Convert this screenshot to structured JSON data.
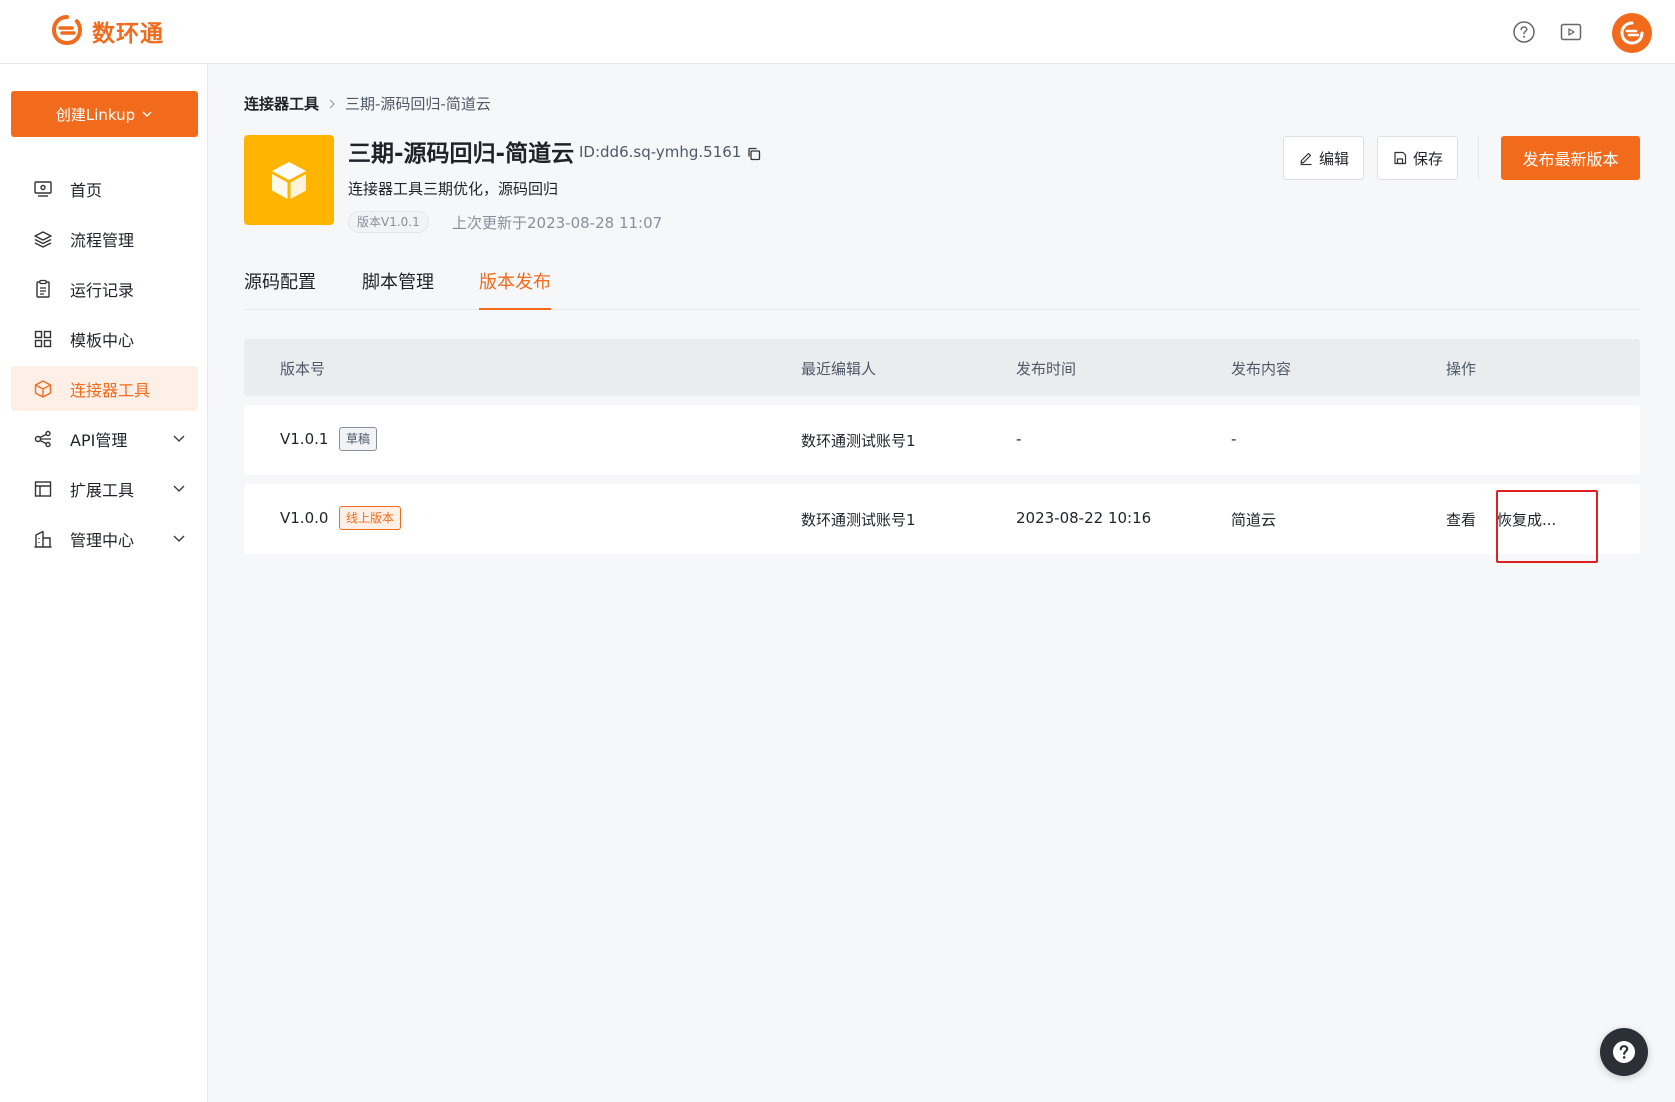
{
  "brand": {
    "name": "数环通",
    "accent": "#f26b1d"
  },
  "topbar": {
    "icons": [
      "help-circle-icon",
      "video-play-icon",
      "user-avatar-icon"
    ]
  },
  "sidebar": {
    "create_label": "创建Linkup",
    "items": [
      {
        "label": "首页",
        "icon": "monitor-icon",
        "active": false,
        "expandable": false
      },
      {
        "label": "流程管理",
        "icon": "layers-icon",
        "active": false,
        "expandable": false
      },
      {
        "label": "运行记录",
        "icon": "clipboard-icon",
        "active": false,
        "expandable": false
      },
      {
        "label": "模板中心",
        "icon": "grid-icon",
        "active": false,
        "expandable": false
      },
      {
        "label": "连接器工具",
        "icon": "cube-icon",
        "active": true,
        "expandable": false
      },
      {
        "label": "API管理",
        "icon": "api-icon",
        "active": false,
        "expandable": true
      },
      {
        "label": "扩展工具",
        "icon": "extension-icon",
        "active": false,
        "expandable": true
      },
      {
        "label": "管理中心",
        "icon": "building-icon",
        "active": false,
        "expandable": true
      }
    ]
  },
  "breadcrumb": {
    "root": "连接器工具",
    "separator": ">",
    "current": "三期-源码回归-简道云"
  },
  "connector": {
    "title": "三期-源码回归-简道云",
    "id_text": "ID:dd6.sq-ymhg.5161",
    "description": "连接器工具三期优化，源码回归",
    "version_tag": "版本V1.0.1",
    "updated": "上次更新于2023-08-28 11:07"
  },
  "actions": {
    "edit": "编辑",
    "save": "保存",
    "publish": "发布最新版本"
  },
  "tabs": [
    {
      "label": "源码配置",
      "active": false
    },
    {
      "label": "脚本管理",
      "active": false
    },
    {
      "label": "版本发布",
      "active": true
    }
  ],
  "table": {
    "headers": [
      "版本号",
      "最近编辑人",
      "发布时间",
      "发布内容",
      "操作"
    ],
    "rows": [
      {
        "version": "V1.0.1",
        "tag": "草稿",
        "editor": "数环通测试账号1",
        "time": "-",
        "content": "-",
        "actions": []
      },
      {
        "version": "V1.0.0",
        "tag": "线上版本",
        "editor": "数环通测试账号1",
        "time": "2023-08-22 10:16",
        "content": "简道云",
        "actions": [
          "查看",
          "恢复成..."
        ]
      }
    ]
  },
  "colors": {
    "highlight_box": "#e02020",
    "connector_icon_bg": "#ffb500"
  }
}
